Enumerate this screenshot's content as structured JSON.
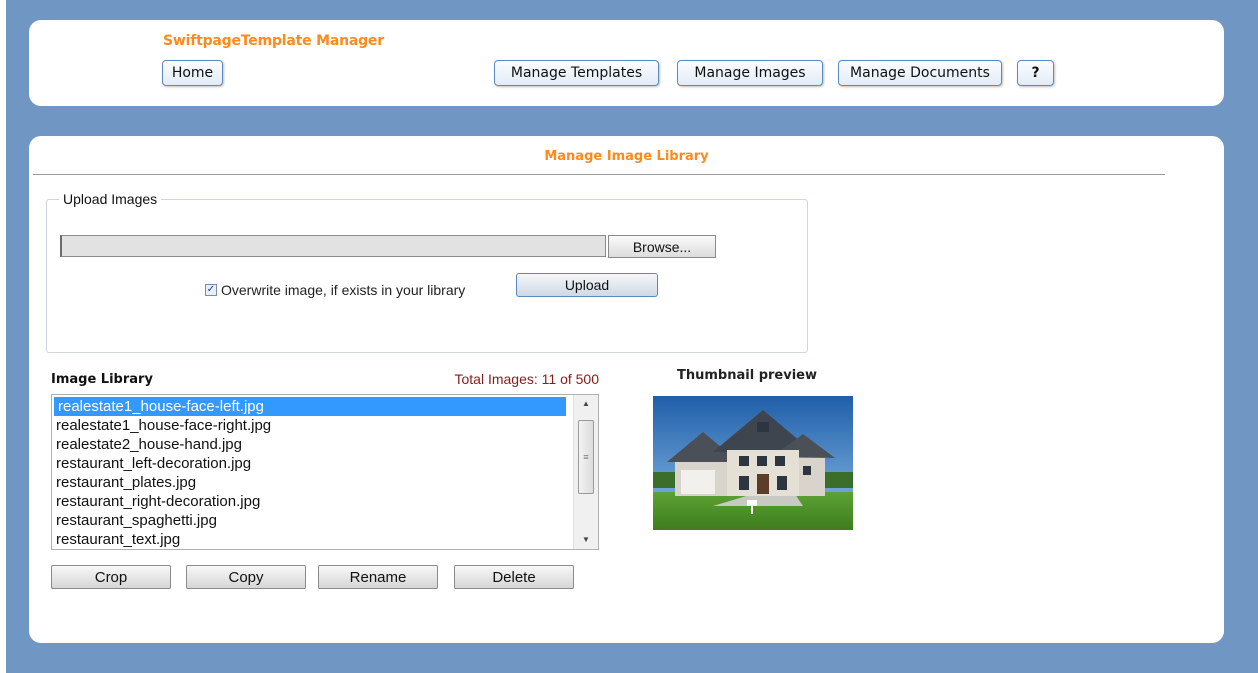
{
  "header": {
    "brand": "SwiftpageTemplate Manager",
    "nav": {
      "home": "Home",
      "manage_templates": "Manage Templates",
      "manage_images": "Manage Images",
      "manage_documents": "Manage Documents",
      "help": "?"
    }
  },
  "main": {
    "title": "Manage Image Library",
    "upload": {
      "legend": "Upload Images",
      "file_value": "",
      "browse_label": "Browse...",
      "overwrite_checked": true,
      "overwrite_label": "Overwrite image, if exists in your library",
      "upload_label": "Upload"
    },
    "library": {
      "title": "Image Library",
      "total_text": "Total Images: 11 of 500",
      "items": [
        "realestate1_house-face-left.jpg",
        "realestate1_house-face-right.jpg",
        "realestate2_house-hand.jpg",
        "restaurant_left-decoration.jpg",
        "restaurant_plates.jpg",
        "restaurant_right-decoration.jpg",
        "restaurant_spaghetti.jpg",
        "restaurant_text.jpg"
      ],
      "selected_index": 0
    },
    "thumbnail": {
      "title": "Thumbnail preview"
    },
    "actions": {
      "crop": "Crop",
      "copy": "Copy",
      "rename": "Rename",
      "delete": "Delete"
    }
  }
}
